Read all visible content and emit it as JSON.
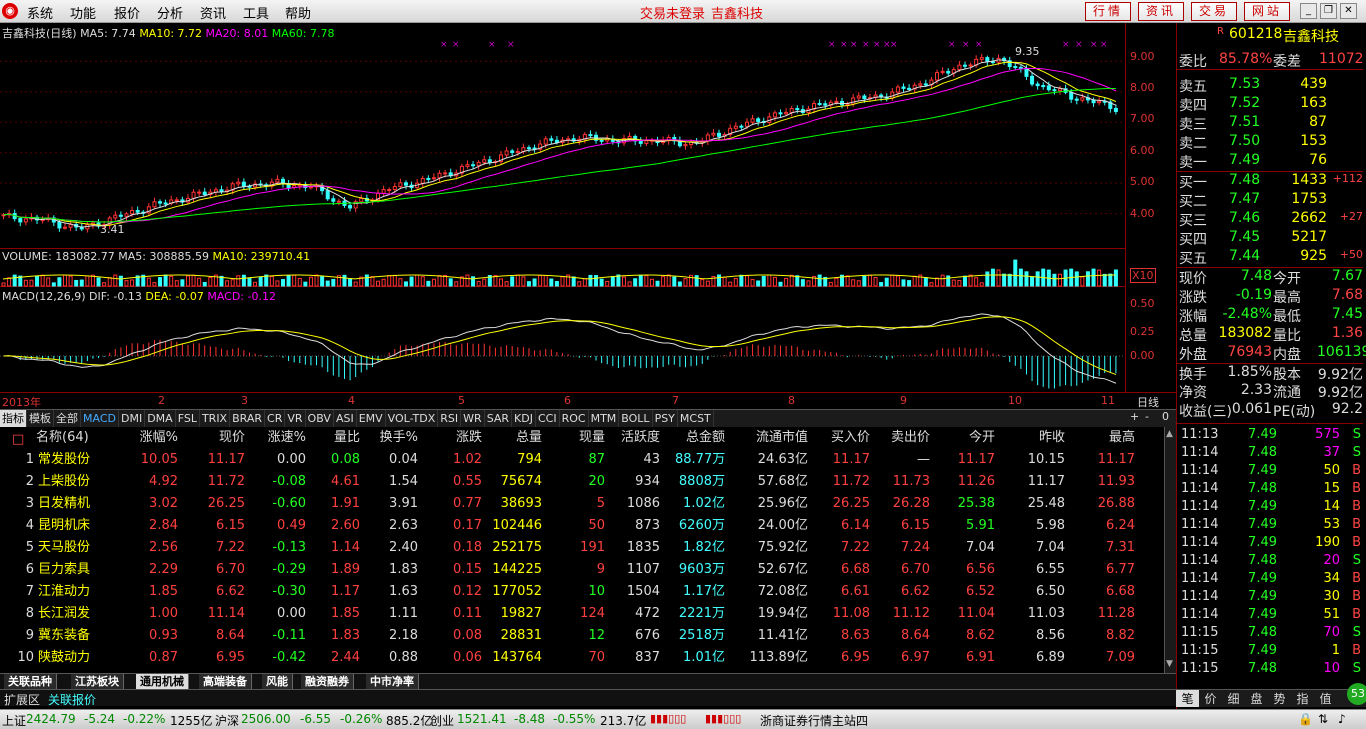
{
  "menu": {
    "items": [
      "系统",
      "功能",
      "报价",
      "分析",
      "资讯",
      "工具",
      "帮助"
    ],
    "center": [
      "交易未登录",
      "吉鑫科技"
    ],
    "buttons": [
      "行情",
      "资讯",
      "交易",
      "网站"
    ]
  },
  "kline": {
    "title": "吉鑫科技(日线)",
    "ma5": "MA5: 7.74",
    "ma10": "MA10: 7.72",
    "ma20": "MA20: 8.01",
    "ma60": "MA60: 7.78",
    "high_label": "9.35",
    "low_label": "3.41"
  },
  "volume": {
    "vol": "VOLUME: 183082.77",
    "ma5": "MA5: 308885.59",
    "ma10": "MA10: 239710.41",
    "scale": "X10"
  },
  "macd": {
    "title": "MACD(12,26,9)",
    "dif": "DIF: -0.13",
    "dea": "DEA: -0.07",
    "macd": "MACD: -0.12",
    "ticks": [
      "0.50",
      "0.25",
      "0.00"
    ]
  },
  "price_ticks": [
    "9.00",
    "8.00",
    "7.00",
    "6.00",
    "5.00",
    "4.00"
  ],
  "date_axis": {
    "year": "2013年",
    "months": [
      "2",
      "3",
      "4",
      "5",
      "6",
      "7",
      "8",
      "9",
      "10",
      "11"
    ],
    "period": "日线"
  },
  "indicator_tabs": [
    "指标",
    "模板",
    "全部",
    "MACD",
    "DMI",
    "DMA",
    "FSL",
    "TRIX",
    "BRAR",
    "CR",
    "VR",
    "OBV",
    "ASI",
    "EMV",
    "VOL-TDX",
    "RSI",
    "WR",
    "SAR",
    "KDJ",
    "CCI",
    "ROC",
    "MTM",
    "BOLL",
    "PSY",
    "MCST"
  ],
  "table": {
    "headers": [
      "名称(64)",
      "涨幅%",
      "现价",
      "涨速%",
      "量比",
      "换手%",
      "涨跌",
      "总量",
      "现量",
      "活跃度",
      "总金额",
      "流通市值",
      "买入价",
      "卖出价",
      "今开",
      "昨收",
      "最高"
    ],
    "rows": [
      [
        "1",
        "常发股份",
        "10.05",
        "11.17",
        "0.00",
        "0.08",
        "0.04",
        "1.02",
        "794",
        "87",
        "43",
        "88.77万",
        "24.63亿",
        "11.17",
        "—",
        "11.17",
        "10.15",
        "11.17"
      ],
      [
        "2",
        "上柴股份",
        "4.92",
        "11.72",
        "-0.08",
        "4.61",
        "1.54",
        "0.55",
        "75674",
        "20",
        "934",
        "8808万",
        "57.68亿",
        "11.72",
        "11.73",
        "11.26",
        "11.17",
        "11.93"
      ],
      [
        "3",
        "日发精机",
        "3.02",
        "26.25",
        "-0.60",
        "1.91",
        "3.91",
        "0.77",
        "38693",
        "5",
        "1086",
        "1.02亿",
        "25.96亿",
        "26.25",
        "26.28",
        "25.38",
        "25.48",
        "26.88"
      ],
      [
        "4",
        "昆明机床",
        "2.84",
        "6.15",
        "0.49",
        "2.60",
        "2.63",
        "0.17",
        "102446",
        "50",
        "873",
        "6260万",
        "24.00亿",
        "6.14",
        "6.15",
        "5.91",
        "5.98",
        "6.24"
      ],
      [
        "5",
        "天马股份",
        "2.56",
        "7.22",
        "-0.13",
        "1.14",
        "2.40",
        "0.18",
        "252175",
        "191",
        "1835",
        "1.82亿",
        "75.92亿",
        "7.22",
        "7.24",
        "7.04",
        "7.04",
        "7.31"
      ],
      [
        "6",
        "巨力索具",
        "2.29",
        "6.70",
        "-0.29",
        "1.89",
        "1.83",
        "0.15",
        "144225",
        "9",
        "1107",
        "9603万",
        "52.67亿",
        "6.68",
        "6.70",
        "6.56",
        "6.55",
        "6.77"
      ],
      [
        "7",
        "江淮动力",
        "1.85",
        "6.62",
        "-0.30",
        "1.17",
        "1.63",
        "0.12",
        "177052",
        "10",
        "1504",
        "1.17亿",
        "72.08亿",
        "6.61",
        "6.62",
        "6.52",
        "6.50",
        "6.68"
      ],
      [
        "8",
        "长江润发",
        "1.00",
        "11.14",
        "0.00",
        "1.85",
        "1.11",
        "0.11",
        "19827",
        "124",
        "472",
        "2221万",
        "19.94亿",
        "11.08",
        "11.12",
        "11.04",
        "11.03",
        "11.28"
      ],
      [
        "9",
        "冀东装备",
        "0.93",
        "8.64",
        "-0.11",
        "1.83",
        "2.18",
        "0.08",
        "28831",
        "12",
        "676",
        "2518万",
        "11.41亿",
        "8.63",
        "8.64",
        "8.62",
        "8.56",
        "8.82"
      ],
      [
        "10",
        "陕鼓动力",
        "0.87",
        "6.95",
        "-0.42",
        "2.44",
        "0.88",
        "0.06",
        "143764",
        "70",
        "837",
        "1.01亿",
        "113.89亿",
        "6.95",
        "6.97",
        "6.91",
        "6.89",
        "7.09"
      ]
    ]
  },
  "sheet_tabs": [
    "关联品种",
    "江苏板块",
    "通用机械",
    "高端装备",
    "风能",
    "融资融券",
    "中市净率"
  ],
  "ext_bar": [
    "扩展区",
    "关联报价"
  ],
  "status": {
    "sh_name": "上证",
    "sh_val": "2424.79",
    "sh_chg": "-5.24",
    "sh_pct": "-0.22%",
    "sh_amt": "1255亿",
    "sz_name": "沪深",
    "sz_val": "2506.00",
    "sz_chg": "-6.55",
    "sz_pct": "-0.26%",
    "sz_amt": "885.2亿",
    "cy_name": "创业",
    "cy_val": "1521.41",
    "cy_chg": "-8.48",
    "cy_pct": "-0.55%",
    "cy_amt": "213.7亿",
    "station": "浙商证券行情主站四"
  },
  "quote": {
    "r": "R",
    "code": "601218",
    "name": "吉鑫科技",
    "weibi_label": "委比",
    "weibi": "85.78%",
    "weicha_label": "委差",
    "weicha": "11072",
    "asks": [
      [
        "卖五",
        "7.53",
        "439",
        ""
      ],
      [
        "卖四",
        "7.52",
        "163",
        ""
      ],
      [
        "卖三",
        "7.51",
        "87",
        ""
      ],
      [
        "卖二",
        "7.50",
        "153",
        ""
      ],
      [
        "卖一",
        "7.49",
        "76",
        ""
      ]
    ],
    "bids": [
      [
        "买一",
        "7.48",
        "1433",
        "+112"
      ],
      [
        "买二",
        "7.47",
        "1753",
        ""
      ],
      [
        "买三",
        "7.46",
        "2662",
        "+27"
      ],
      [
        "买四",
        "7.45",
        "5217",
        ""
      ],
      [
        "买五",
        "7.44",
        "925",
        "+50"
      ]
    ],
    "stats": [
      [
        "现价",
        "7.48",
        "今开",
        "7.67"
      ],
      [
        "涨跌",
        "-0.19",
        "最高",
        "7.68"
      ],
      [
        "涨幅",
        "-2.48%",
        "最低",
        "7.45"
      ],
      [
        "总量",
        "183082",
        "量比",
        "1.36"
      ],
      [
        "外盘",
        "76943",
        "内盘",
        "106139"
      ],
      [
        "换手",
        "1.85%",
        "股本",
        "9.92亿"
      ],
      [
        "净资",
        "2.33",
        "流通",
        "9.92亿"
      ],
      [
        "收益(三)",
        "0.061",
        "PE(动)",
        "92.2"
      ]
    ]
  },
  "ticks": [
    [
      "11:13",
      "7.49",
      "575",
      "S"
    ],
    [
      "11:14",
      "7.48",
      "37",
      "S"
    ],
    [
      "11:14",
      "7.49",
      "50",
      "B"
    ],
    [
      "11:14",
      "7.48",
      "15",
      "B"
    ],
    [
      "11:14",
      "7.49",
      "14",
      "B"
    ],
    [
      "11:14",
      "7.49",
      "53",
      "B"
    ],
    [
      "11:14",
      "7.49",
      "190",
      "B"
    ],
    [
      "11:14",
      "7.48",
      "20",
      "S"
    ],
    [
      "11:14",
      "7.49",
      "34",
      "B"
    ],
    [
      "11:14",
      "7.49",
      "30",
      "B"
    ],
    [
      "11:14",
      "7.49",
      "51",
      "B"
    ],
    [
      "11:15",
      "7.48",
      "70",
      "S"
    ],
    [
      "11:15",
      "7.49",
      "1",
      "B"
    ],
    [
      "11:15",
      "7.48",
      "10",
      "S"
    ]
  ],
  "right_tabs": [
    "笔",
    "价",
    "细",
    "盘",
    "势",
    "指",
    "值"
  ],
  "chart_data": {
    "type": "candlestick",
    "series_close_approx": [
      3.9,
      3.8,
      3.5,
      3.9,
      4.3,
      4.6,
      4.9,
      5.0,
      4.9,
      4.2,
      4.8,
      5.1,
      5.5,
      5.9,
      6.3,
      6.5,
      6.4,
      6.4,
      6.3,
      6.8,
      7.2,
      7.5,
      7.7,
      7.9,
      8.3,
      8.9,
      9.1,
      8.2,
      7.8,
      7.48
    ]
  }
}
